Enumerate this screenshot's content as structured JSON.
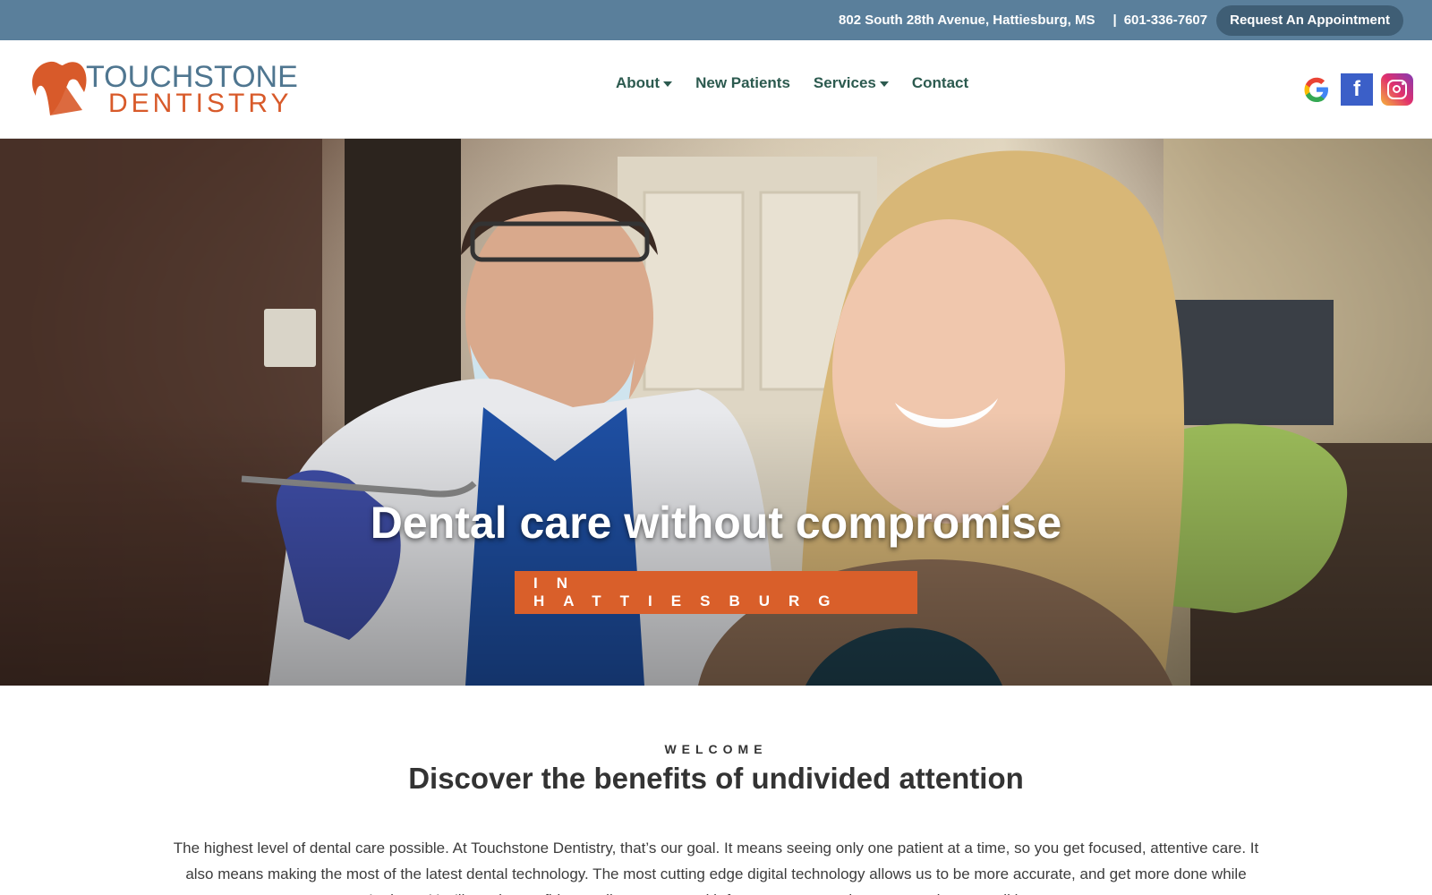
{
  "topbar": {
    "address": "802 South 28th Avenue, Hattiesburg, MS",
    "separator": "|",
    "phone": "601-336-7607",
    "appointment_label": "Request An Appointment"
  },
  "header": {
    "logo_line1": "TOUCHSTONE",
    "logo_line2": "DENTISTRY",
    "nav": [
      {
        "label": "About",
        "has_dropdown": true
      },
      {
        "label": "New Patients",
        "has_dropdown": false
      },
      {
        "label": "Services",
        "has_dropdown": true
      },
      {
        "label": "Contact",
        "has_dropdown": false
      }
    ],
    "social_icons": [
      "google-icon",
      "facebook-icon",
      "instagram-icon"
    ]
  },
  "hero": {
    "title": "Dental care without compromise",
    "badge": "IN HATTIESBURG"
  },
  "welcome": {
    "eyebrow": "WELCOME",
    "title": "Discover the benefits of undivided attention",
    "body": "The highest level of dental care possible. At Touchstone Dentistry, that’s our goal. It means seeing only one patient at a time, so you get focused, attentive care. It also means making the most of the latest dental technology. The most cutting edge digital technology allows us to be more accurate, and get more done while you’re here. You’ll get the confident smile you want, with fewer repeat appointments, and an overall lower cost."
  },
  "colors": {
    "topbar": "#5a7f9b",
    "appointment_button": "#3f5e75",
    "brand_orange": "#d95f2a",
    "brand_blue": "#4f7690",
    "nav_text": "#2c5a4f"
  }
}
